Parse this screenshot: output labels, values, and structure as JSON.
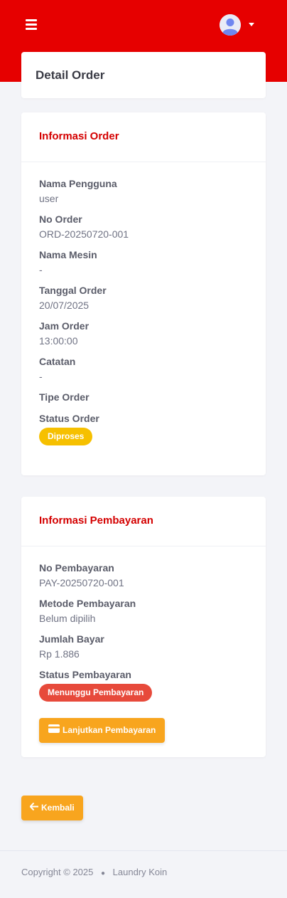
{
  "topbar": {
    "menu_icon": "hamburger-menu-icon",
    "avatar_icon": "user-avatar-icon",
    "caret_icon": "caret-down-icon",
    "accent_color": "#e60000"
  },
  "page": {
    "title": "Detail Order"
  },
  "order_info": {
    "title": "Informasi Order",
    "fields": [
      {
        "label": "Nama Pengguna",
        "value": "user"
      },
      {
        "label": "No Order",
        "value": "ORD-20250720-001"
      },
      {
        "label": "Nama Mesin",
        "value": "-"
      },
      {
        "label": "Tanggal Order",
        "value": "20/07/2025"
      },
      {
        "label": "Jam Order",
        "value": "13:00:00"
      },
      {
        "label": "Catatan",
        "value": "-"
      },
      {
        "label": "Tipe Order",
        "value": ""
      },
      {
        "label": "Status Order",
        "value": "Diproses"
      }
    ]
  },
  "payment_info": {
    "title": "Informasi Pembayaran",
    "fields": [
      {
        "label": "No Pembayaran",
        "value": "PAY-20250720-001"
      },
      {
        "label": "Metode Pembayaran",
        "value": "Belum dipilih"
      },
      {
        "label": "Jumlah Bayar",
        "value": "Rp 1.886"
      },
      {
        "label": "Status Pembayaran",
        "value": "Menunggu Pembayaran"
      }
    ],
    "continue_button": {
      "label": "Lanjutkan Pembayaran",
      "icon": "credit-card-icon"
    }
  },
  "back_button": {
    "label": "Kembali",
    "icon": "arrow-left-icon"
  },
  "footer": {
    "copyright": "Copyright © 2025",
    "brand": "Laundry Koin"
  }
}
